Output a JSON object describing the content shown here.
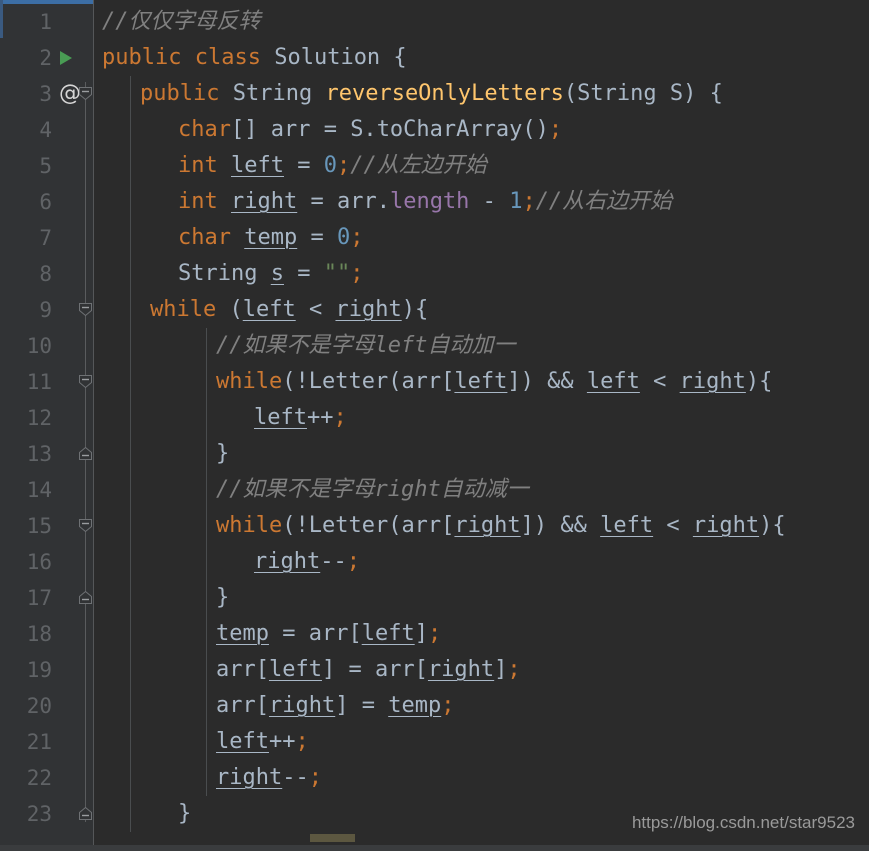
{
  "editor": {
    "name": "intellij-code-editor",
    "theme": "darcula",
    "background_color": "#2b2b2b",
    "gutter_color": "#313335",
    "accent_color": "#3c6ea5",
    "scrollbar_color": "#5c5740",
    "total_lines": 23,
    "line_height": 36
  },
  "colors": {
    "keyword": "#cc7832",
    "string": "#6a8759",
    "number": "#6897bb",
    "comment": "#808080",
    "method": "#ffc66d",
    "field": "#9876aa",
    "default_text": "#a9b7c6",
    "line_number": "#606366",
    "run_marker_green": "#499c54"
  },
  "gutter": {
    "line_numbers": [
      "1",
      "2",
      "3",
      "4",
      "5",
      "6",
      "7",
      "8",
      "9",
      "10",
      "11",
      "12",
      "13",
      "14",
      "15",
      "16",
      "17",
      "18",
      "19",
      "20",
      "21",
      "22",
      "23"
    ],
    "markers": [
      {
        "line": 2,
        "icon": "run-triangle-icon",
        "label": "Run Solution"
      },
      {
        "line": 3,
        "icon": "override-at-icon",
        "label": "@"
      }
    ],
    "fold_markers": [
      {
        "line": 3,
        "icon": "fold-collapse-down-icon"
      },
      {
        "line": 9,
        "icon": "fold-collapse-down-icon"
      },
      {
        "line": 11,
        "icon": "fold-collapse-down-icon"
      },
      {
        "line": 13,
        "icon": "fold-collapse-up-icon"
      },
      {
        "line": 15,
        "icon": "fold-collapse-down-icon"
      },
      {
        "line": 17,
        "icon": "fold-collapse-up-icon"
      },
      {
        "line": 23,
        "icon": "fold-collapse-up-icon"
      }
    ]
  },
  "code": {
    "lines": [
      {
        "n": 1,
        "indent": 0,
        "tokens": [
          {
            "t": "cmt",
            "v": "//仅仅字母反转"
          }
        ]
      },
      {
        "n": 2,
        "indent": 0,
        "tokens": [
          {
            "t": "kw",
            "v": "public"
          },
          {
            "t": "pln",
            "v": " "
          },
          {
            "t": "kw",
            "v": "class"
          },
          {
            "t": "pln",
            "v": " "
          },
          {
            "t": "typ",
            "v": "Solution"
          },
          {
            "t": "pln",
            "v": " {"
          }
        ]
      },
      {
        "n": 3,
        "indent": 1,
        "tokens": [
          {
            "t": "kw",
            "v": "public"
          },
          {
            "t": "pln",
            "v": " "
          },
          {
            "t": "typ",
            "v": "String"
          },
          {
            "t": "pln",
            "v": " "
          },
          {
            "t": "mth",
            "v": "reverseOnlyLetters"
          },
          {
            "t": "pln",
            "v": "("
          },
          {
            "t": "typ",
            "v": "String"
          },
          {
            "t": "pln",
            "v": " S) {"
          }
        ]
      },
      {
        "n": 4,
        "indent": 2,
        "tokens": [
          {
            "t": "kw",
            "v": "char"
          },
          {
            "t": "pln",
            "v": "[] arr = S."
          },
          {
            "t": "pln",
            "v": "toCharArray()"
          },
          {
            "t": "sem",
            "v": ";"
          }
        ]
      },
      {
        "n": 5,
        "indent": 2,
        "tokens": [
          {
            "t": "kw",
            "v": "int"
          },
          {
            "t": "pln",
            "v": " "
          },
          {
            "t": "var",
            "v": "left"
          },
          {
            "t": "pln",
            "v": " = "
          },
          {
            "t": "num",
            "v": "0"
          },
          {
            "t": "sem",
            "v": ";"
          },
          {
            "t": "cmt",
            "v": "//从左边开始"
          }
        ]
      },
      {
        "n": 6,
        "indent": 2,
        "tokens": [
          {
            "t": "kw",
            "v": "int"
          },
          {
            "t": "pln",
            "v": " "
          },
          {
            "t": "var",
            "v": "right"
          },
          {
            "t": "pln",
            "v": " = arr."
          },
          {
            "t": "fld",
            "v": "length"
          },
          {
            "t": "pln",
            "v": " - "
          },
          {
            "t": "num",
            "v": "1"
          },
          {
            "t": "sem",
            "v": ";"
          },
          {
            "t": "cmt",
            "v": "//从右边开始"
          }
        ]
      },
      {
        "n": 7,
        "indent": 2,
        "tokens": [
          {
            "t": "kw",
            "v": "char"
          },
          {
            "t": "pln",
            "v": " "
          },
          {
            "t": "var",
            "v": "temp"
          },
          {
            "t": "pln",
            "v": " = "
          },
          {
            "t": "num",
            "v": "0"
          },
          {
            "t": "sem",
            "v": ";"
          }
        ]
      },
      {
        "n": 8,
        "indent": 2,
        "tokens": [
          {
            "t": "typ",
            "v": "String"
          },
          {
            "t": "pln",
            "v": " "
          },
          {
            "t": "var",
            "v": "s"
          },
          {
            "t": "pln",
            "v": " = "
          },
          {
            "t": "str",
            "v": "\"\""
          },
          {
            "t": "sem",
            "v": ";"
          }
        ]
      },
      {
        "n": 9,
        "indent": 2,
        "tokens": [
          {
            "t": "kw",
            "v": "while"
          },
          {
            "t": "pln",
            "v": " ("
          },
          {
            "t": "var",
            "v": "left"
          },
          {
            "t": "pln",
            "v": " < "
          },
          {
            "t": "var",
            "v": "right"
          },
          {
            "t": "pln",
            "v": "){"
          }
        ],
        "offset": -28
      },
      {
        "n": 10,
        "indent": 3,
        "tokens": [
          {
            "t": "cmt",
            "v": "//如果不是字母left自动加一"
          }
        ]
      },
      {
        "n": 11,
        "indent": 3,
        "tokens": [
          {
            "t": "kw",
            "v": "while"
          },
          {
            "t": "pln",
            "v": "(!Letter(arr["
          },
          {
            "t": "var",
            "v": "left"
          },
          {
            "t": "pln",
            "v": "]) && "
          },
          {
            "t": "var",
            "v": "left"
          },
          {
            "t": "pln",
            "v": " < "
          },
          {
            "t": "var",
            "v": "right"
          },
          {
            "t": "pln",
            "v": "){"
          }
        ]
      },
      {
        "n": 12,
        "indent": 4,
        "tokens": [
          {
            "t": "var",
            "v": "left"
          },
          {
            "t": "pln",
            "v": "++"
          },
          {
            "t": "sem",
            "v": ";"
          }
        ]
      },
      {
        "n": 13,
        "indent": 3,
        "tokens": [
          {
            "t": "pln",
            "v": "}"
          }
        ]
      },
      {
        "n": 14,
        "indent": 3,
        "tokens": [
          {
            "t": "cmt",
            "v": "//如果不是字母right自动减一"
          }
        ]
      },
      {
        "n": 15,
        "indent": 3,
        "tokens": [
          {
            "t": "kw",
            "v": "while"
          },
          {
            "t": "pln",
            "v": "(!Letter(arr["
          },
          {
            "t": "var",
            "v": "right"
          },
          {
            "t": "pln",
            "v": "]) && "
          },
          {
            "t": "var",
            "v": "left"
          },
          {
            "t": "pln",
            "v": " < "
          },
          {
            "t": "var",
            "v": "right"
          },
          {
            "t": "pln",
            "v": "){"
          }
        ]
      },
      {
        "n": 16,
        "indent": 4,
        "tokens": [
          {
            "t": "var",
            "v": "right"
          },
          {
            "t": "pln",
            "v": "--"
          },
          {
            "t": "sem",
            "v": ";"
          }
        ]
      },
      {
        "n": 17,
        "indent": 3,
        "tokens": [
          {
            "t": "pln",
            "v": "}"
          }
        ]
      },
      {
        "n": 18,
        "indent": 3,
        "tokens": [
          {
            "t": "var",
            "v": "temp"
          },
          {
            "t": "pln",
            "v": " = arr["
          },
          {
            "t": "var",
            "v": "left"
          },
          {
            "t": "pln",
            "v": "]"
          },
          {
            "t": "sem",
            "v": ";"
          }
        ]
      },
      {
        "n": 19,
        "indent": 3,
        "tokens": [
          {
            "t": "pln",
            "v": "arr["
          },
          {
            "t": "var",
            "v": "left"
          },
          {
            "t": "pln",
            "v": "] = arr["
          },
          {
            "t": "var",
            "v": "right"
          },
          {
            "t": "pln",
            "v": "]"
          },
          {
            "t": "sem",
            "v": ";"
          }
        ]
      },
      {
        "n": 20,
        "indent": 3,
        "tokens": [
          {
            "t": "pln",
            "v": "arr["
          },
          {
            "t": "var",
            "v": "right"
          },
          {
            "t": "pln",
            "v": "] = "
          },
          {
            "t": "var",
            "v": "temp"
          },
          {
            "t": "sem",
            "v": ";"
          }
        ]
      },
      {
        "n": 21,
        "indent": 3,
        "tokens": [
          {
            "t": "var",
            "v": "left"
          },
          {
            "t": "pln",
            "v": "++"
          },
          {
            "t": "sem",
            "v": ";"
          }
        ]
      },
      {
        "n": 22,
        "indent": 3,
        "tokens": [
          {
            "t": "var",
            "v": "right"
          },
          {
            "t": "pln",
            "v": "--"
          },
          {
            "t": "sem",
            "v": ";"
          }
        ]
      },
      {
        "n": 23,
        "indent": 2,
        "tokens": [
          {
            "t": "pln",
            "v": "}"
          }
        ]
      }
    ]
  },
  "watermark": {
    "text": "https://blog.csdn.net/star9523"
  }
}
